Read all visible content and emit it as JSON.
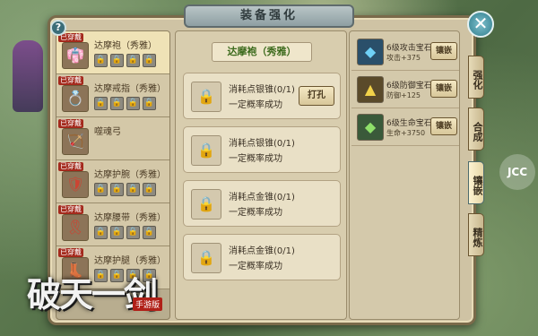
{
  "window": {
    "title": "装备强化",
    "help": "?",
    "close": "✕"
  },
  "equipment": [
    {
      "worn": "已穿戴",
      "name": "达摩袍（秀雅）",
      "icon": "robe-icon",
      "slot_count": 4,
      "selected": true
    },
    {
      "worn": "已穿戴",
      "name": "达摩戒指（秀雅）",
      "icon": "ring-icon",
      "slot_count": 4,
      "selected": false
    },
    {
      "worn": "已穿戴",
      "name": "噬魂弓",
      "icon": "bow-icon",
      "slot_count": 0,
      "selected": false
    },
    {
      "worn": "已穿戴",
      "name": "达摩护腕（秀雅）",
      "icon": "bracer-icon",
      "slot_count": 4,
      "selected": false
    },
    {
      "worn": "已穿戴",
      "name": "达摩腰带（秀雅）",
      "icon": "belt-icon",
      "slot_count": 4,
      "selected": false
    },
    {
      "worn": "已穿戴",
      "name": "达摩护腿（秀雅）",
      "icon": "leggings-icon",
      "slot_count": 4,
      "selected": false
    }
  ],
  "middle": {
    "item_title": "达摩袍（秀雅）",
    "slots": [
      {
        "line1": "消耗点银锥(0/1)",
        "line2": "一定概率成功",
        "button": "打孔"
      },
      {
        "line1": "消耗点银锥(0/1)",
        "line2": "一定概率成功",
        "button": ""
      },
      {
        "line1": "消耗点金锥(0/1)",
        "line2": "一定概率成功",
        "button": ""
      },
      {
        "line1": "消耗点金锥(0/1)",
        "line2": "一定概率成功",
        "button": ""
      }
    ]
  },
  "gems": [
    {
      "name": "6级攻击宝石",
      "stat": "攻击+375",
      "button": "镶嵌",
      "color": "#2a8fc0"
    },
    {
      "name": "6级防御宝石",
      "stat": "防御+125",
      "button": "镶嵌",
      "color": "#d7b12a"
    },
    {
      "name": "6级生命宝石",
      "stat": "生命+3750",
      "button": "镶嵌",
      "color": "#58b94a"
    }
  ],
  "tabs": [
    "强化",
    "合成",
    "镶嵌",
    "精炼"
  ],
  "active_tab": "镶嵌",
  "branding": {
    "logo": "破天一剑",
    "badge": "手游版",
    "watermark": "JCC"
  }
}
